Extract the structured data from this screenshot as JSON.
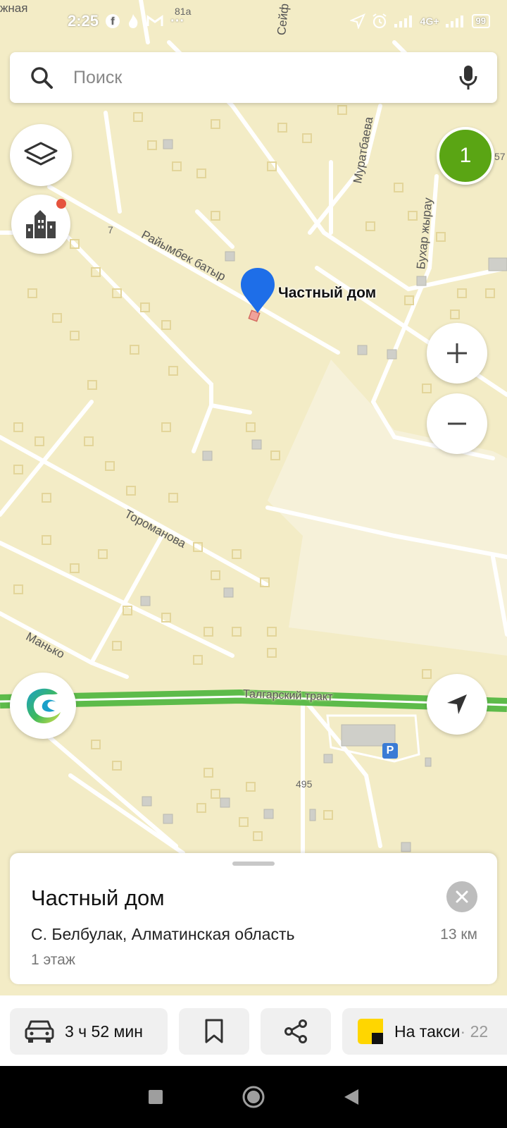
{
  "status_bar": {
    "time": "2:25",
    "network": "4G+",
    "battery": "99"
  },
  "search": {
    "placeholder": "Поиск"
  },
  "map": {
    "streets": {
      "raiymbek": "Райымбек батыр",
      "toromanova": "Тороманова",
      "manko": "Манько",
      "talgar": "Талгарский тракт",
      "buhar": "Бухар жырау",
      "muratbaeva": "Муратбаева",
      "seyf": "Сейф",
      "top_left": "жная"
    },
    "house_numbers": {
      "n81a": "81а",
      "n7": "7",
      "n495": "495",
      "n57": "57"
    },
    "parking_letter": "P",
    "cluster_count": "1",
    "pin_label": "Частный дом"
  },
  "place": {
    "title": "Частный дом",
    "address": "С. Белбулак, Алматинская область",
    "floors": "1 этаж",
    "distance": "13 км"
  },
  "actions": {
    "route_time": "3 ч 52 мин",
    "taxi_label": "На такси",
    "taxi_price": " · 22"
  },
  "colors": {
    "map_background": "#f3ecc6",
    "main_road": "#5dbb4a",
    "pin": "#1e6ee8",
    "cluster": "#5aa514",
    "taxi_yellow": "#ffd600"
  }
}
